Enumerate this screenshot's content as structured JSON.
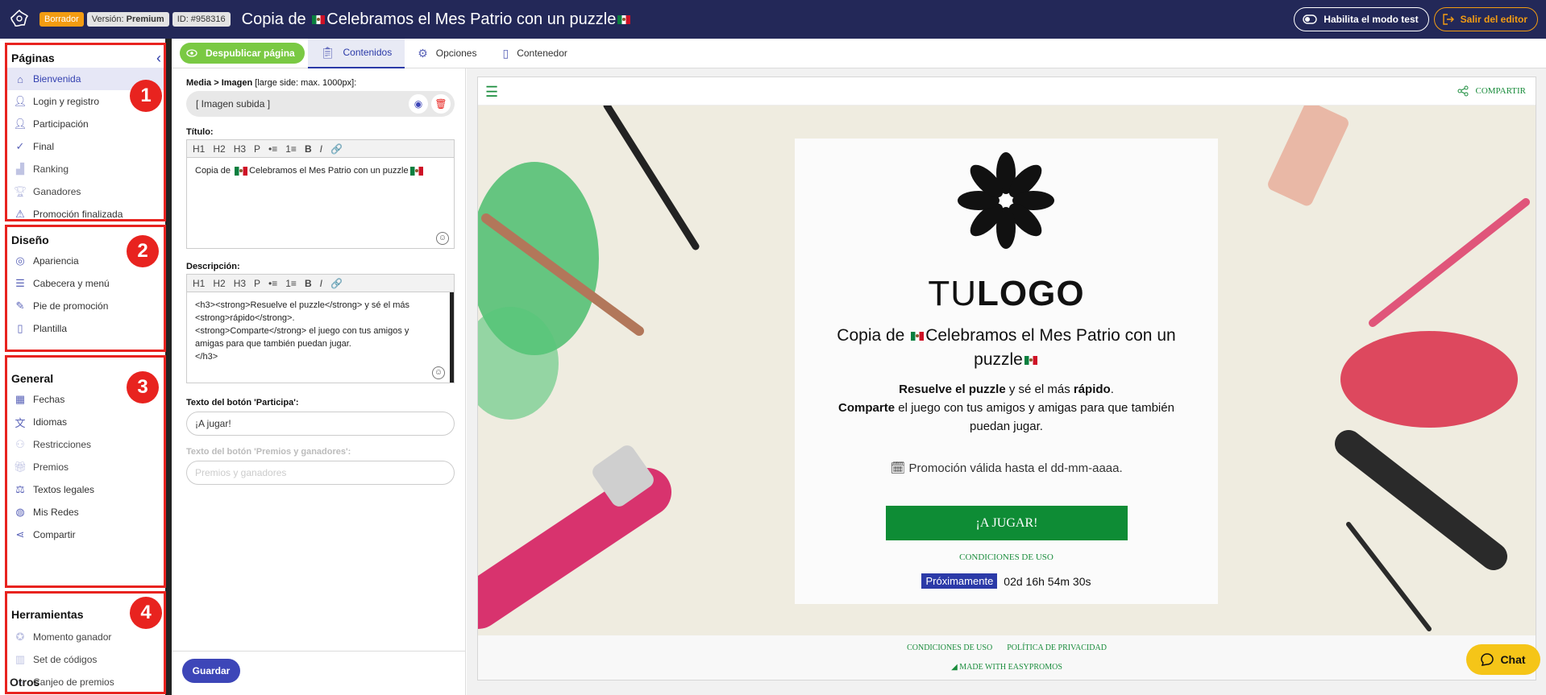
{
  "topbar": {
    "badge_status": "Borrador",
    "badge_version_label": "Versión:",
    "badge_version_value": "Premium",
    "badge_id": "ID: #958316",
    "title_prefix": "Copia de",
    "title_main": "Celebramos el Mes Patrio con un puzzle",
    "test_mode_label": "Habilita el modo test",
    "exit_label": "Salir del editor"
  },
  "sidebar": {
    "sections": [
      {
        "title": "Páginas",
        "items": [
          "Bienvenida",
          "Login y registro",
          "Participación",
          "Final",
          "Ranking",
          "Ganadores",
          "Promoción finalizada"
        ]
      },
      {
        "title": "Diseño",
        "items": [
          "Apariencia",
          "Cabecera y menú",
          "Pie de promoción",
          "Plantilla"
        ]
      },
      {
        "title": "General",
        "items": [
          "Fechas",
          "Idiomas",
          "Restricciones",
          "Premios",
          "Textos legales",
          "Mis Redes",
          "Compartir"
        ]
      },
      {
        "title": "Herramientas",
        "items": [
          "Momento ganador",
          "Set de códigos",
          "Canjeo de premios"
        ]
      }
    ],
    "badges": [
      "1",
      "2",
      "3",
      "4"
    ],
    "otros": "Otros"
  },
  "tabs": {
    "publish": "Despublicar página",
    "contenidos": "Contenidos",
    "opciones": "Opciones",
    "contenedor": "Contenedor"
  },
  "form": {
    "media_label": "Media > Imagen",
    "media_hint": "[large side: max. 1000px]:",
    "media_value": "[ Imagen subida ]",
    "titulo_label": "Título:",
    "toolbar": [
      "H1",
      "H2",
      "H3",
      "P",
      "•≡",
      "1≡",
      "B",
      "I",
      "🔗"
    ],
    "titulo_prefix": "Copia de",
    "titulo_main": "Celebramos el Mes Patrio con un puzzle",
    "descripcion_label": "Descripción:",
    "descripcion_lines": [
      "<h3><strong>Resuelve el puzzle</strong> y sé el más",
      "<strong>rápido</strong>.",
      "<strong>Comparte</strong> el juego con tus amigos y",
      "amigas para que también puedan jugar.",
      "</h3>"
    ],
    "btn_participa_label": "Texto del botón 'Participa':",
    "btn_participa_value": "¡A jugar!",
    "btn_premios_label": "Texto del botón 'Premios y ganadores':",
    "btn_premios_placeholder": "Premios y ganadores",
    "save": "Guardar"
  },
  "preview": {
    "share": "COMPARTIR",
    "logo_thin": "TU",
    "logo_bold": "LOGO",
    "title_prefix": "Copia de",
    "title_main": "Celebramos el Mes Patrio con un puzzle",
    "desc_strong1": "Resuelve el puzzle",
    "desc_mid1": " y sé el más ",
    "desc_strong2": "rápido",
    "desc_end1": ".",
    "desc_strong3": "Comparte",
    "desc_rest": " el juego con tus amigos y amigas para que también puedan jugar.",
    "valid": "Promoción válida hasta el dd-mm-aaaa.",
    "cta": "¡A JUGAR!",
    "conditions": "CONDICIONES DE USO",
    "soon": "Próximamente",
    "timer": "02d 16h 54m 30s",
    "footer_conditions": "CONDICIONES DE USO",
    "footer_privacy": "POLÍTICA DE PRIVACIDAD",
    "made_with": "MADE WITH EASYPROMOS"
  },
  "chat": "Chat",
  "colors": {
    "topbar": "#232858",
    "accent": "#2b3aa8",
    "highlight_red": "#e8231f",
    "brand_green": "#0e8c35",
    "publish_green": "#7ac943",
    "chat_yellow": "#f5c518"
  }
}
